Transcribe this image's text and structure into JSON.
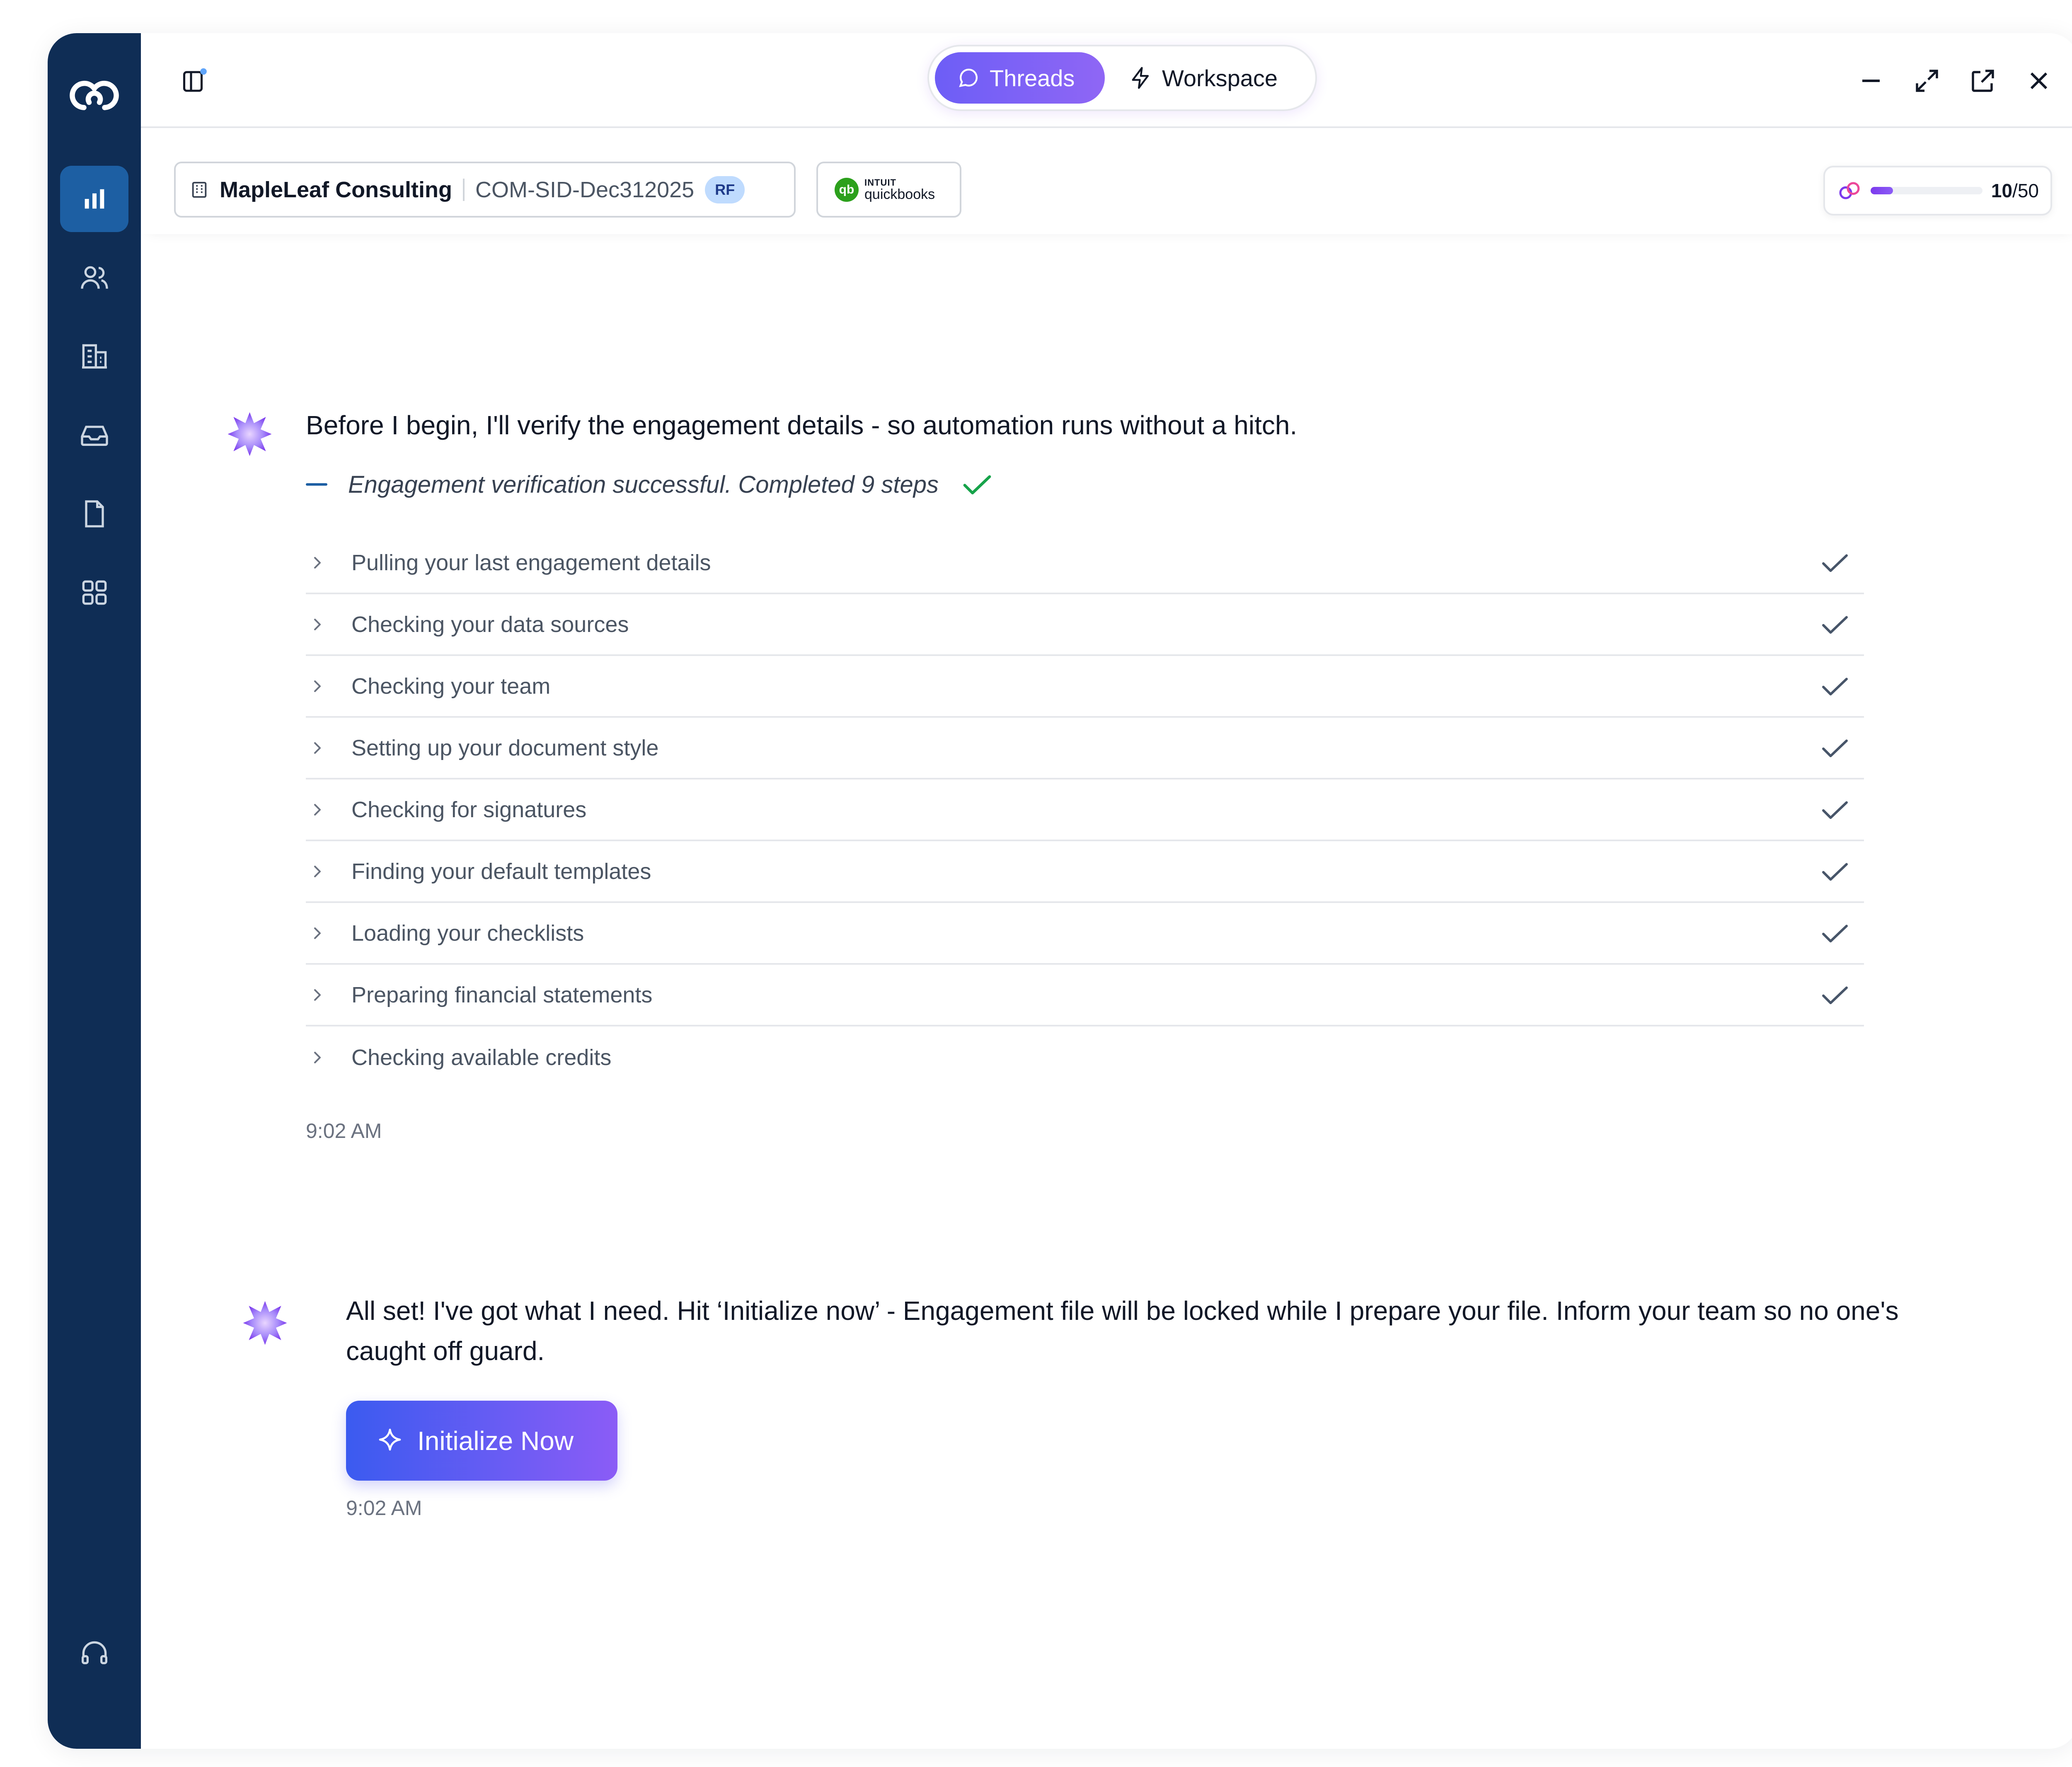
{
  "topbar": {
    "tabs": [
      {
        "label": "Threads",
        "active": true,
        "icon": "chat-bubble-icon"
      },
      {
        "label": "Workspace",
        "active": false,
        "icon": "lightning-icon"
      }
    ]
  },
  "context": {
    "client_name": "MapleLeaf Consulting",
    "engagement_code": "COM-SID-Dec312025",
    "badge": "RF",
    "integration": {
      "line1": "INTUIT",
      "line2": "quickbooks",
      "mark": "qb"
    },
    "credits": {
      "used": "10",
      "total": "/50",
      "fraction": 0.2
    }
  },
  "messages": [
    {
      "text": "Before I begin, I'll verify the engagement details - so automation runs without a hitch.",
      "status": "Engagement verification successful. Completed 9 steps",
      "steps": [
        {
          "label": "Pulling your last engagement details",
          "done": true
        },
        {
          "label": "Checking your data sources",
          "done": true
        },
        {
          "label": "Checking your team",
          "done": true
        },
        {
          "label": "Setting up your document style",
          "done": true
        },
        {
          "label": "Checking for signatures",
          "done": true
        },
        {
          "label": "Finding your default templates",
          "done": true
        },
        {
          "label": "Loading your checklists",
          "done": true
        },
        {
          "label": "Preparing financial statements",
          "done": true
        },
        {
          "label": "Checking available credits",
          "done": false
        }
      ],
      "time": "9:02 AM"
    },
    {
      "text": "All set! I've got what I need. Hit ‘Initialize now’ - Engagement file will be locked while I prepare your file. Inform your team so no one's caught off guard.",
      "button_label": "Initialize Now",
      "time": "9:02 AM"
    }
  ],
  "colors": {
    "sidebar": "#0f2d55",
    "sidebar_active": "#1d5fa3",
    "accent_start": "#6d5ef6",
    "accent_end": "#8f66f5",
    "success": "#16a34a"
  }
}
